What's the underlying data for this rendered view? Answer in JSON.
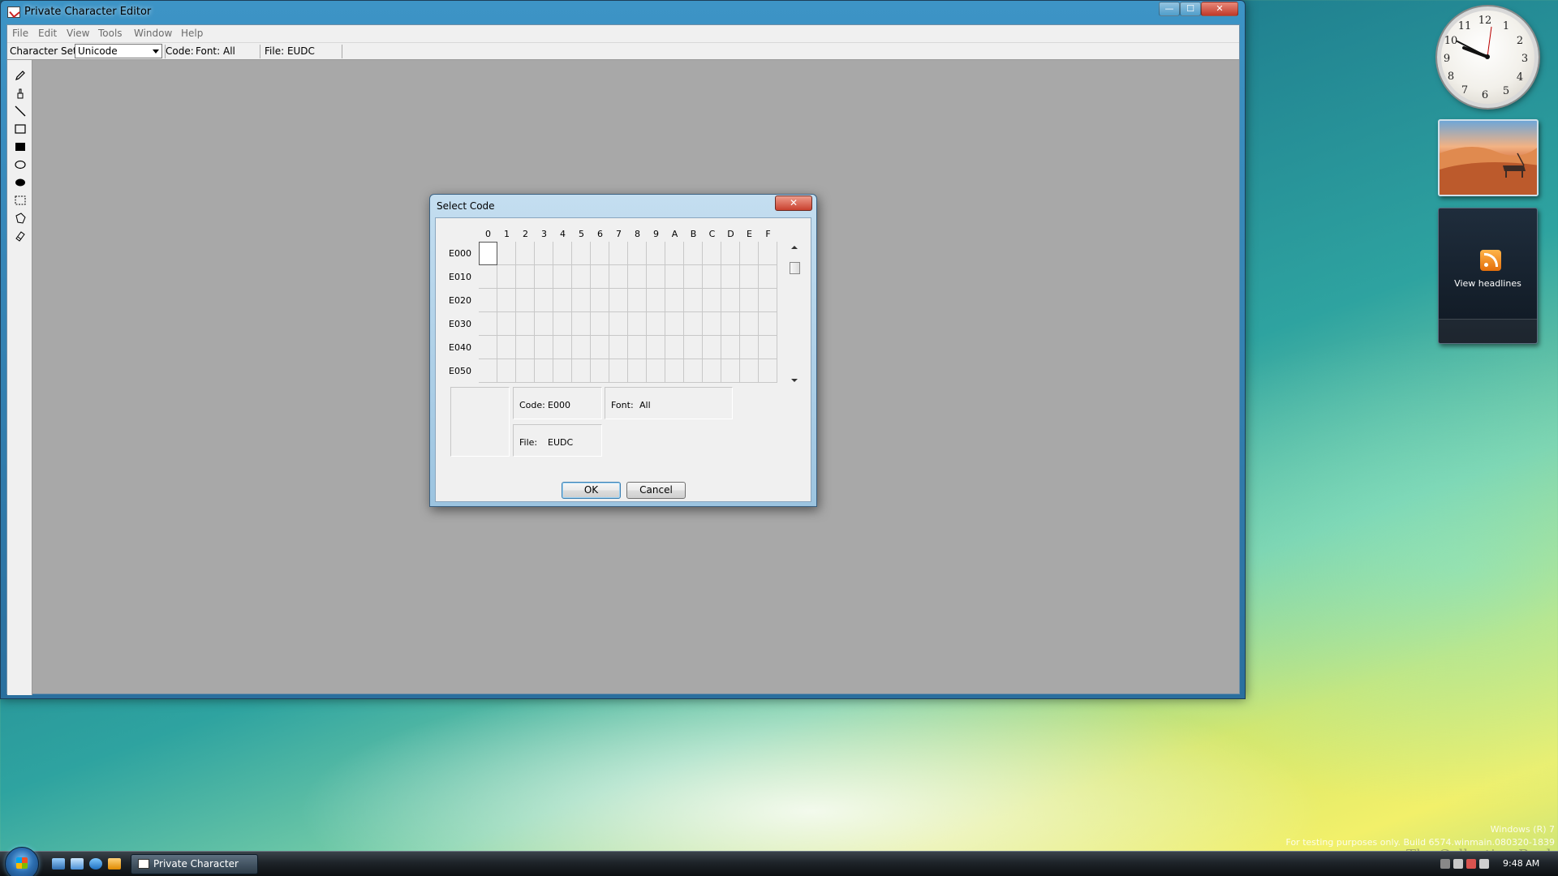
{
  "window": {
    "title": "Private Character Editor"
  },
  "menu": [
    "File",
    "Edit",
    "View",
    "Tools",
    "Window",
    "Help"
  ],
  "toolbar": {
    "charset_label": "Character Set:",
    "charset_value": "Unicode",
    "code_label": "Code:",
    "font_label": "Font: All",
    "file_label": "File: EUDC"
  },
  "tools": [
    "pencil-icon",
    "brush-icon",
    "line-icon",
    "hollow-rectangle-icon",
    "filled-rectangle-icon",
    "hollow-ellipse-icon",
    "filled-ellipse-icon",
    "rectangular-selection-icon",
    "freeform-selection-icon",
    "eraser-icon"
  ],
  "dialog": {
    "title": "Select Code",
    "close": "✕",
    "columns": [
      "0",
      "1",
      "2",
      "3",
      "4",
      "5",
      "6",
      "7",
      "8",
      "9",
      "A",
      "B",
      "C",
      "D",
      "E",
      "F"
    ],
    "rows": [
      "E000",
      "E010",
      "E020",
      "E030",
      "E040",
      "E050"
    ],
    "selected_cell": {
      "row": "E000",
      "column": "0"
    },
    "code_label": "Code:",
    "code_value": "E000",
    "font_label": "Font:",
    "font_value": "All",
    "file_label": "File:",
    "file_value": "EUDC",
    "ok_label": "OK",
    "cancel_label": "Cancel"
  },
  "gadgets": {
    "clock_numbers": [
      "12",
      "1",
      "2",
      "3",
      "4",
      "5",
      "6",
      "7",
      "8",
      "9",
      "10",
      "11"
    ],
    "feed_label": "View headlines"
  },
  "watermark": {
    "line1": "Windows (R) 7",
    "line2": "For testing purposes only. Build 6574.winmain.080320-1839",
    "book": "The Collection Book"
  },
  "taskbar": {
    "task_label": "Private Character Ed...",
    "time": "9:48 AM"
  },
  "colors": {
    "dialog_close": "#c9412f",
    "window_frame": "#3d94c6",
    "workspace": "#a8a8a8"
  }
}
